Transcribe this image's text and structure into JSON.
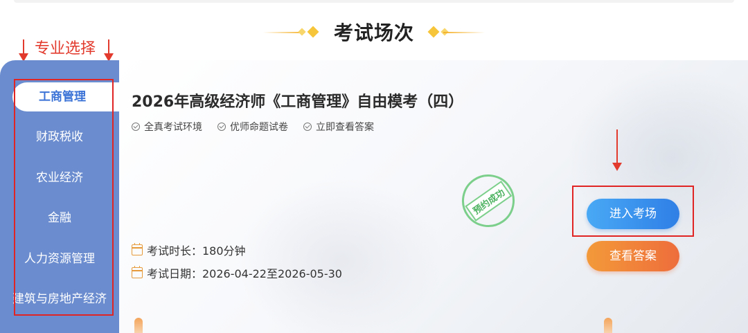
{
  "header": {
    "title": "考试场次"
  },
  "annotation": {
    "label": "专业选择"
  },
  "sidebar": {
    "items": [
      {
        "label": "工商管理",
        "active": true
      },
      {
        "label": "财政税收"
      },
      {
        "label": "农业经济"
      },
      {
        "label": "金融"
      },
      {
        "label": "人力资源管理"
      },
      {
        "label": "建筑与房地产经济"
      }
    ]
  },
  "exam": {
    "title": "2026年高级经济师《工商管理》自由模考（四）",
    "features": [
      "全真考试环境",
      "优师命题试卷",
      "立即查看答案"
    ],
    "stamp": "预约成功",
    "duration": "考试时长：180分钟",
    "date": "考试日期：2026-04-22至2026-05-30",
    "enter_label": "进入考场",
    "answer_label": "查看答案"
  },
  "colors": {
    "sidebar_bg": "#6b8dcf",
    "active_text": "#3b73d6",
    "annotation_red": "#e02424",
    "enter_button": "#2f7fe6",
    "answer_button": "#ee6d3b",
    "stamp_green": "#4cb260"
  }
}
